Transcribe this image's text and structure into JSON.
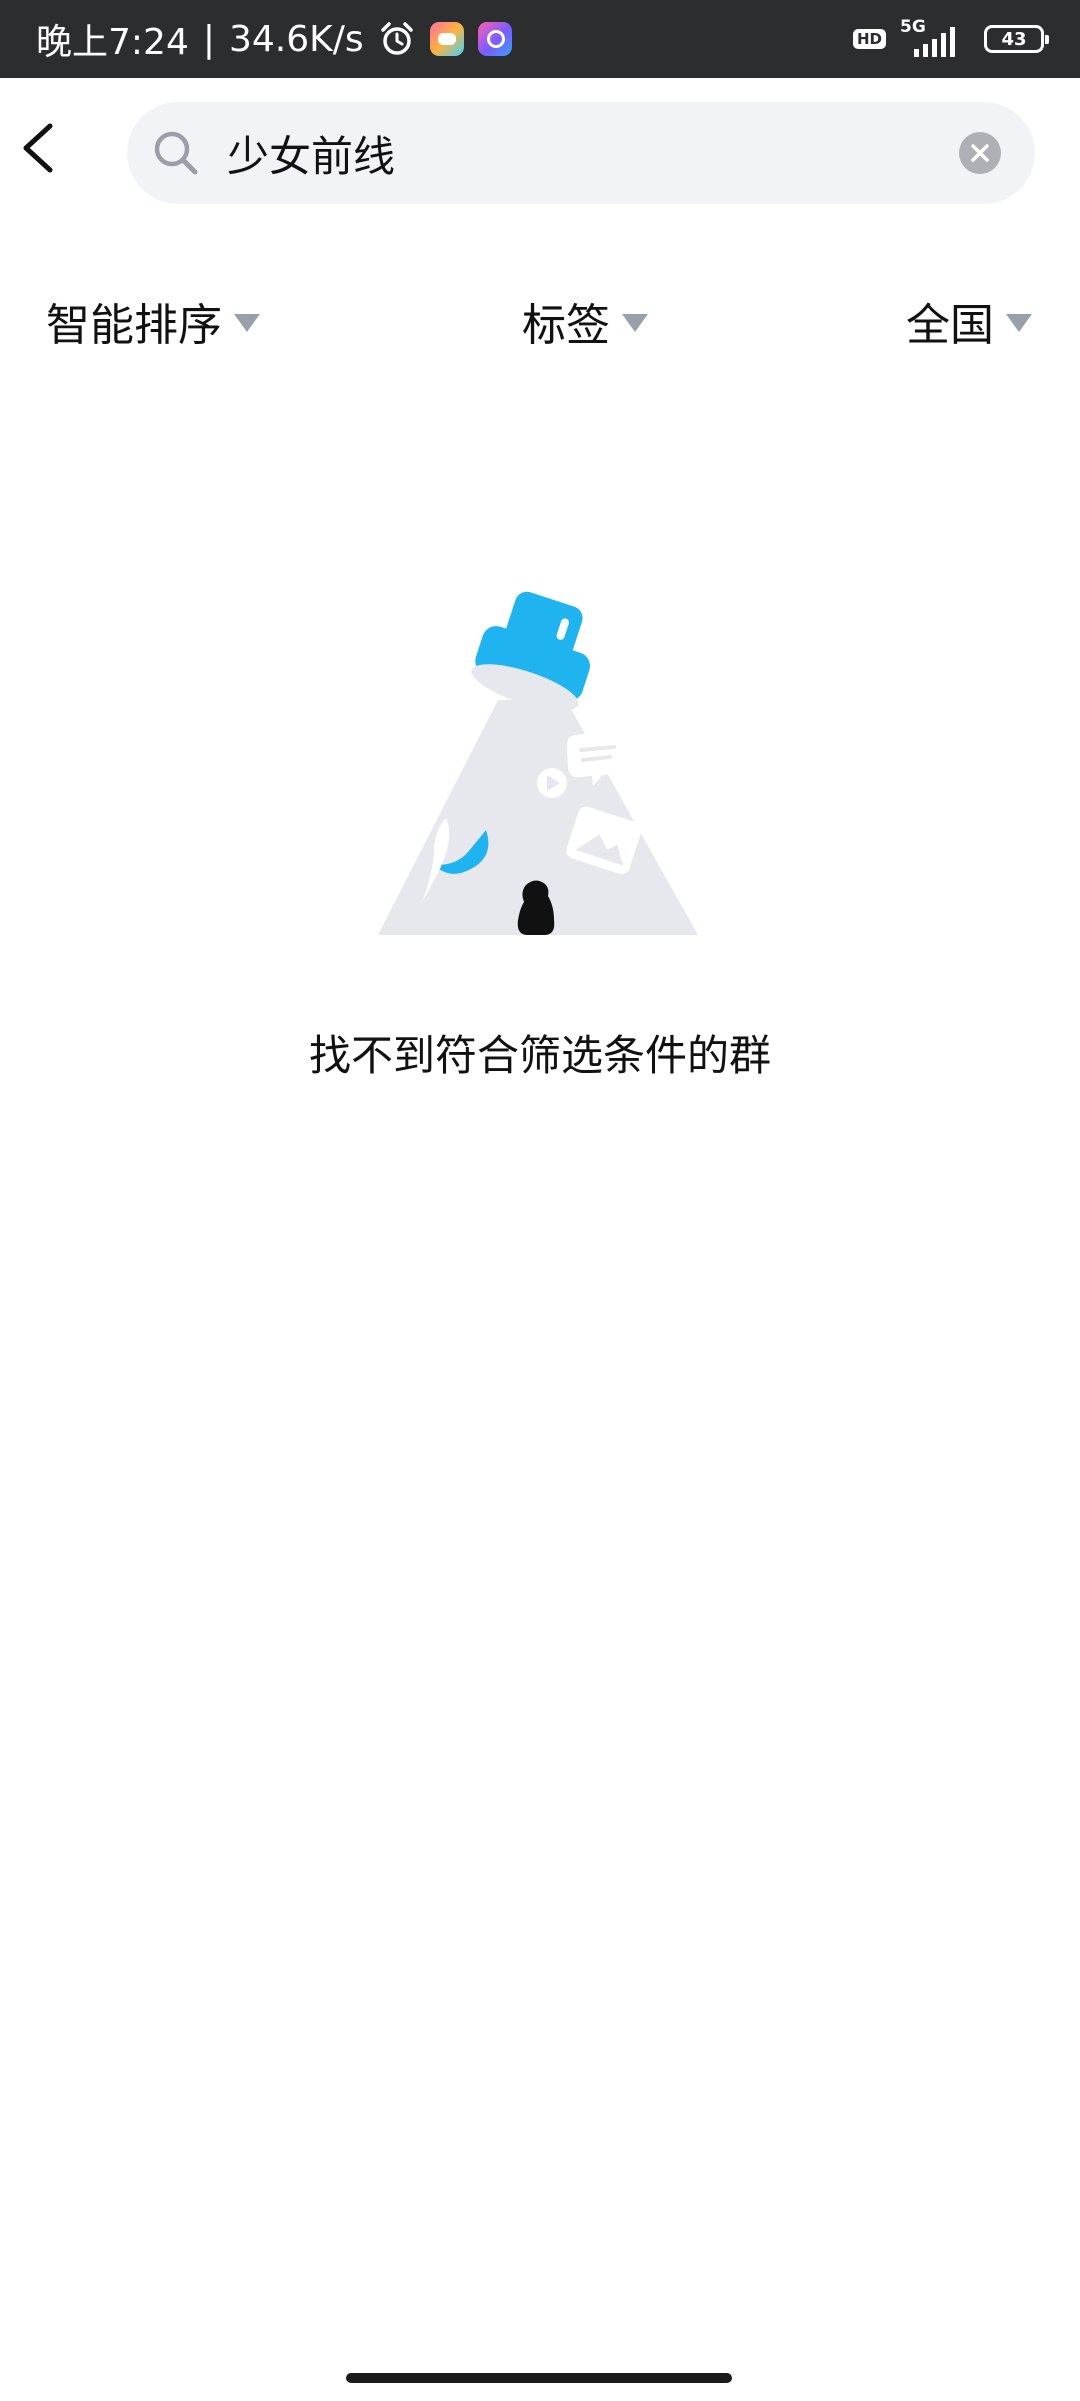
{
  "status_bar": {
    "time": "晚上7:24",
    "separator": "|",
    "network_speed": "34.6K/s",
    "hd_label": "HD",
    "network_type": "5G",
    "battery_level": "43",
    "icons": [
      "alarm-icon",
      "game-app-icon",
      "search-app-icon",
      "hd-icon",
      "signal-icon",
      "battery-icon"
    ]
  },
  "search": {
    "query": "少女前线",
    "icons": [
      "back-arrow-icon",
      "search-icon",
      "clear-icon"
    ]
  },
  "filters": {
    "sort": "智能排序",
    "tag": "标签",
    "region": "全国",
    "arrow_icon": "triangle-down-icon"
  },
  "empty_state": {
    "message": "找不到符合筛选条件的群",
    "illustration": "flashlight-penguin-illustration"
  },
  "colors": {
    "status_bar_bg": "#2b2d2e",
    "search_bg": "#f2f3f7",
    "accent_blue": "#1fb3f0",
    "filter_arrow": "#9aa0aa",
    "text": "#111111"
  }
}
